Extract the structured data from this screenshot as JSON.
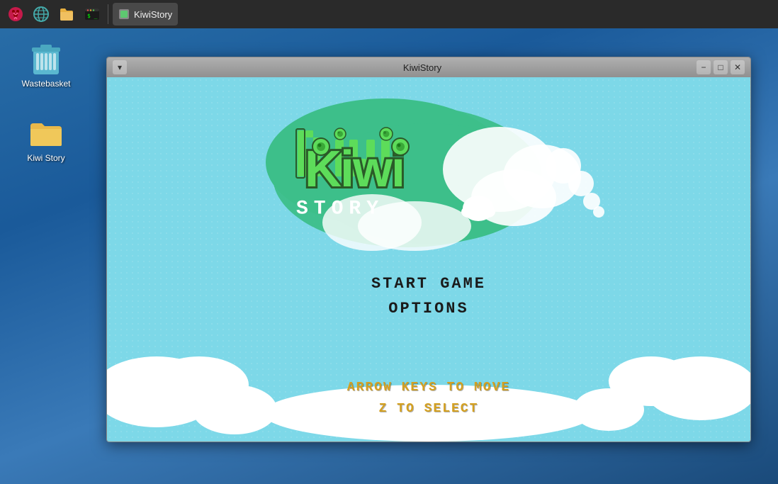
{
  "taskbar": {
    "icons": [
      {
        "name": "raspberry-pi-icon",
        "label": "Raspberry Pi"
      },
      {
        "name": "browser-icon",
        "label": "Browser"
      },
      {
        "name": "files-icon",
        "label": "Files"
      },
      {
        "name": "terminal-icon",
        "label": "Terminal"
      }
    ],
    "window_button": {
      "label": "KiwiStory",
      "icon": "kiwistory-icon"
    }
  },
  "desktop": {
    "icons": [
      {
        "name": "wastebasket",
        "label": "Wastebasket",
        "icon_type": "trash"
      },
      {
        "name": "kiwi-story-folder",
        "label": "Kiwi Story",
        "icon_type": "folder"
      }
    ]
  },
  "window": {
    "title": "KiwiStory",
    "controls": [
      "minimize",
      "maximize",
      "close"
    ]
  },
  "game": {
    "logo_kiwi": "Kiwi",
    "logo_story": "STORY",
    "menu_items": [
      {
        "label": "START GAME",
        "id": "start-game"
      },
      {
        "label": "OPTIONS",
        "id": "options"
      }
    ],
    "controls_hint": [
      "ARROW KEYS TO MOVE",
      "Z TO SELECT"
    ]
  }
}
